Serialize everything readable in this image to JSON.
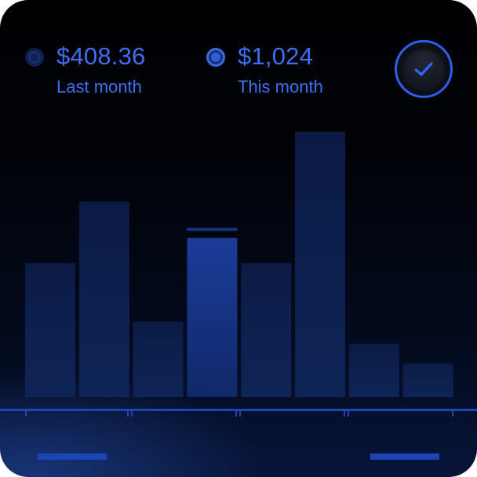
{
  "legend": {
    "last_month": {
      "amount": "$408.36",
      "label": "Last month"
    },
    "this_month": {
      "amount": "$1,024",
      "label": "This month"
    }
  },
  "confirm_button": {
    "icon": "checkmark-icon"
  },
  "colors": {
    "accent": "#3d6ff2",
    "bar": "#0c1c46",
    "bar_highlight": "#1a3a9a",
    "axis": "#1d45b8"
  },
  "chart_data": {
    "type": "bar",
    "values": [
      48,
      70,
      27,
      57,
      48,
      95,
      19,
      12
    ],
    "highlighted_index": 3,
    "marker_value": 60,
    "ylim": [
      0,
      100
    ]
  }
}
